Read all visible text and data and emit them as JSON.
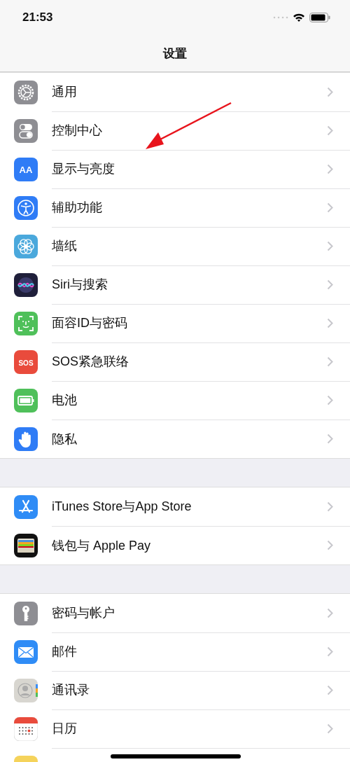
{
  "status_bar": {
    "time": "21:53"
  },
  "nav": {
    "title": "设置"
  },
  "groups": [
    {
      "items": [
        {
          "label": "通用",
          "kind": "gear",
          "color": "#8e8e93"
        },
        {
          "label": "控制中心",
          "kind": "toggles",
          "color": "#8e8e93"
        },
        {
          "label": "显示与亮度",
          "kind": "glyph",
          "glyph": "AA",
          "color": "#2f7cf6"
        },
        {
          "label": "辅助功能",
          "kind": "person",
          "color": "#2f7cf6"
        },
        {
          "label": "墙纸",
          "kind": "flower",
          "color": "#4aa8dc"
        },
        {
          "label": "Siri与搜索",
          "kind": "siri",
          "color": "#1f1f3a"
        },
        {
          "label": "面容ID与密码",
          "kind": "face",
          "color": "#4fc05a"
        },
        {
          "label": "SOS紧急联络",
          "kind": "glyph",
          "glyph": "SOS",
          "color": "#e94b3c"
        },
        {
          "label": "电池",
          "kind": "battery",
          "color": "#4fc05a"
        },
        {
          "label": "隐私",
          "kind": "hand",
          "color": "#2f7cf6"
        }
      ]
    },
    {
      "items": [
        {
          "label": "iTunes Store与App Store",
          "kind": "appstore",
          "color": "#2f8cf6"
        },
        {
          "label": "钱包与 Apple Pay",
          "kind": "wallet",
          "color": "#111111"
        }
      ]
    },
    {
      "items": [
        {
          "label": "密码与帐户",
          "kind": "key",
          "color": "#8e8e93"
        },
        {
          "label": "邮件",
          "kind": "mail",
          "color": "#2f8cf6"
        },
        {
          "label": "通讯录",
          "kind": "contacts",
          "color": "#d8d6d0"
        },
        {
          "label": "日历",
          "kind": "calendar"
        },
        {
          "kind": "blank",
          "color": "#f5d35b"
        }
      ]
    }
  ]
}
